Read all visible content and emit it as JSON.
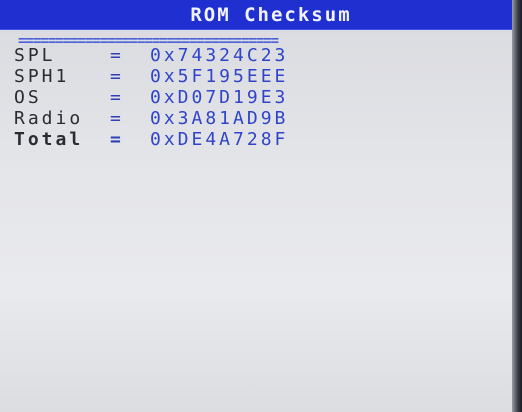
{
  "screen": {
    "title": "ROM Checksum",
    "separator": "===================================",
    "rows": [
      {
        "label": "SPL",
        "eq": "=",
        "value": "0x74324C23"
      },
      {
        "label": "SPH1",
        "eq": "=",
        "value": "0x5F195EEE"
      },
      {
        "label": "OS",
        "eq": "=",
        "value": "0xD07D19E3"
      },
      {
        "label": "Radio",
        "eq": "=",
        "value": "0x3A81AD9B"
      },
      {
        "label": "Total",
        "eq": "=",
        "value": "0xDE4A728F"
      }
    ]
  }
}
